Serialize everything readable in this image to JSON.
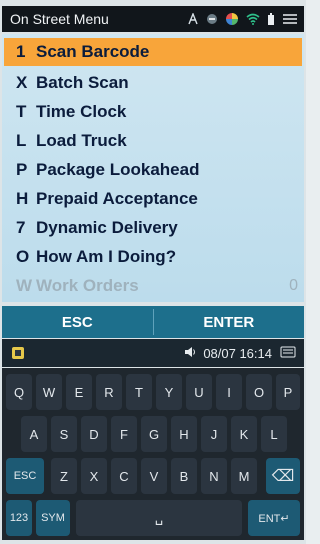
{
  "window": {
    "title": "On Street Menu"
  },
  "status_icons": [
    "wifi-antenna-icon",
    "signal-icon",
    "color-wheel-icon",
    "wifi-icon",
    "battery-icon",
    "menu-icon"
  ],
  "menu": {
    "items": [
      {
        "key": "1",
        "label": "Scan Barcode",
        "selected": true,
        "enabled": true
      },
      {
        "key": "X",
        "label": "Batch Scan",
        "selected": false,
        "enabled": true
      },
      {
        "key": "T",
        "label": "Time Clock",
        "selected": false,
        "enabled": true
      },
      {
        "key": "L",
        "label": "Load Truck",
        "selected": false,
        "enabled": true
      },
      {
        "key": "P",
        "label": "Package Lookahead",
        "selected": false,
        "enabled": true
      },
      {
        "key": "H",
        "label": "Prepaid Acceptance",
        "selected": false,
        "enabled": true
      },
      {
        "key": "7",
        "label": "Dynamic Delivery",
        "selected": false,
        "enabled": true
      },
      {
        "key": "O",
        "label": "How Am I Doing?",
        "selected": false,
        "enabled": true
      },
      {
        "key": "W",
        "label": "Work Orders",
        "selected": false,
        "enabled": false,
        "value": "0"
      }
    ]
  },
  "softkeys": {
    "left": "ESC",
    "right": "ENTER"
  },
  "statusbar": {
    "date_time": "08/07 16:14"
  },
  "keyboard": {
    "row1": [
      "Q",
      "W",
      "E",
      "R",
      "T",
      "Y",
      "U",
      "I",
      "O",
      "P"
    ],
    "row2": [
      "A",
      "S",
      "D",
      "F",
      "G",
      "H",
      "J",
      "K",
      "L"
    ],
    "row3": [
      "ESC",
      "Z",
      "X",
      "C",
      "V",
      "B",
      "N",
      "M",
      "⌫"
    ],
    "row4": [
      "123",
      "SYM",
      "␣",
      "ENT↵"
    ]
  },
  "colors": {
    "selected": "#f8a53a",
    "softkey_bar": "#1d6f8c",
    "menu_bg": "#cfe6f1"
  }
}
